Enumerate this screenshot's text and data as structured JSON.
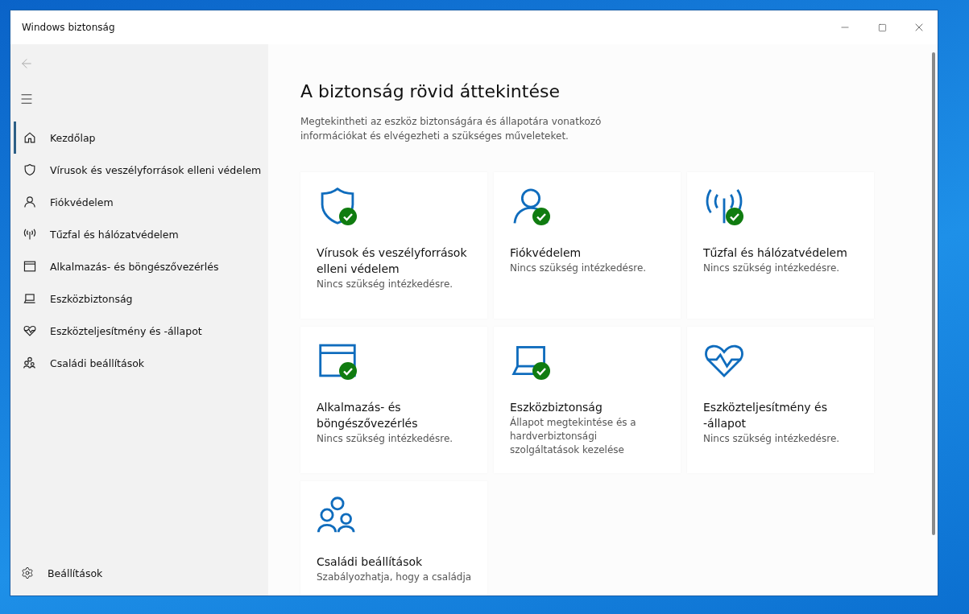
{
  "window": {
    "title": "Windows biztonság"
  },
  "sidebar": {
    "items": [
      {
        "label": "Kezdőlap",
        "selected": true
      },
      {
        "label": "Vírusok és veszélyforrások elleni védelem",
        "selected": false
      },
      {
        "label": "Fiókvédelem",
        "selected": false
      },
      {
        "label": "Tűzfal és hálózatvédelem",
        "selected": false
      },
      {
        "label": "Alkalmazás- és böngészővezérlés",
        "selected": false
      },
      {
        "label": "Eszközbiztonság",
        "selected": false
      },
      {
        "label": "Eszközteljesítmény és -állapot",
        "selected": false
      },
      {
        "label": "Családi beállítások",
        "selected": false
      }
    ],
    "footer": {
      "label": "Beállítások"
    }
  },
  "main": {
    "title": "A biztonság rövid áttekintése",
    "description": "Megtekintheti az eszköz biztonságára és állapotára vonatkozó információkat és elvégezheti a szükséges műveleteket.",
    "cards": [
      {
        "ok": true,
        "title": "Vírusok és veszélyforrások elleni védelem",
        "subtitle": "Nincs szükség intézkedésre."
      },
      {
        "ok": true,
        "title": "Fiókvédelem",
        "subtitle": "Nincs szükség intézkedésre."
      },
      {
        "ok": true,
        "title": "Tűzfal és hálózatvédelem",
        "subtitle": "Nincs szükség intézkedésre."
      },
      {
        "ok": true,
        "title": "Alkalmazás- és böngészővezérlés",
        "subtitle": "Nincs szükség intézkedésre."
      },
      {
        "ok": true,
        "title": "Eszközbiztonság",
        "subtitle": "Állapot megtekintése és a hardverbiztonsági szolgáltatások kezelése"
      },
      {
        "ok": false,
        "title": "Eszközteljesítmény és -állapot",
        "subtitle": "Nincs szükség intézkedésre."
      },
      {
        "ok": false,
        "title": "Családi beállítások",
        "subtitle": "Szabályozhatja, hogy a családja"
      }
    ]
  }
}
